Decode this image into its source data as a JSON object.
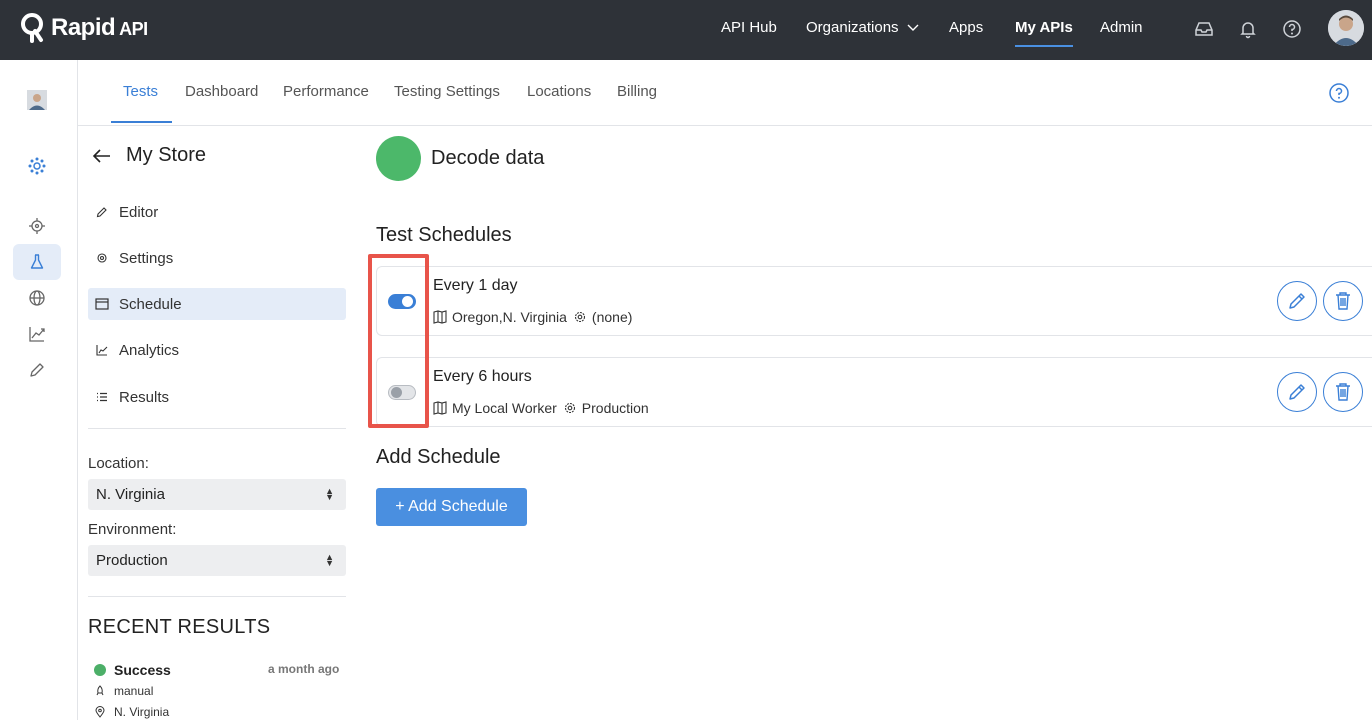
{
  "topbar": {
    "logo_text": "Rapid",
    "logo_suffix": "API",
    "nav": [
      {
        "label": "API Hub"
      },
      {
        "label": "Organizations"
      },
      {
        "label": "Apps"
      },
      {
        "label": "My APIs"
      },
      {
        "label": "Admin"
      }
    ],
    "active_nav": "My APIs"
  },
  "tabs": [
    {
      "label": "Tests"
    },
    {
      "label": "Dashboard"
    },
    {
      "label": "Performance"
    },
    {
      "label": "Testing Settings"
    },
    {
      "label": "Locations"
    },
    {
      "label": "Billing"
    }
  ],
  "sidebar": {
    "title": "My Store",
    "menu": [
      {
        "label": "Editor",
        "icon": "pencil-icon"
      },
      {
        "label": "Settings",
        "icon": "gear-icon"
      },
      {
        "label": "Schedule",
        "icon": "calendar-icon"
      },
      {
        "label": "Analytics",
        "icon": "chart-icon"
      },
      {
        "label": "Results",
        "icon": "list-icon"
      }
    ],
    "active_menu": "Schedule",
    "location_label": "Location:",
    "location_value": "N. Virginia",
    "environment_label": "Environment:",
    "environment_value": "Production",
    "recent_title": "RECENT RESULTS",
    "recent": {
      "status": "Success",
      "time": "a month ago",
      "trigger": "manual",
      "location": "N. Virginia"
    }
  },
  "main": {
    "test_name": "Decode data",
    "schedules_title": "Test Schedules",
    "schedules": [
      {
        "title": "Every 1 day",
        "locations": "Oregon,N. Virginia",
        "environment": "(none)",
        "enabled": true
      },
      {
        "title": "Every 6 hours",
        "locations": "My Local Worker",
        "environment": "Production",
        "enabled": false
      }
    ],
    "add_title": "Add Schedule",
    "add_button": "+ Add Schedule"
  },
  "colors": {
    "topbar": "#2e3238",
    "accent": "#3a7fd6",
    "success": "#4cb86a",
    "highlight": "#e8544a"
  }
}
